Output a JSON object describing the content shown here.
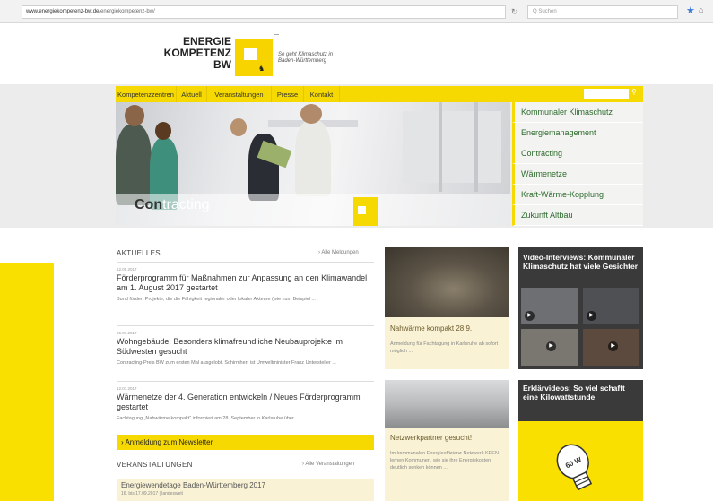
{
  "browser": {
    "url_domain": "www.energiekompetenz-bw.de",
    "url_path": "/energiekompetenz-bw/",
    "search_placeholder": "Q Suchen"
  },
  "logo": {
    "line1": "ENERGIE",
    "line2": "KOMPETENZ",
    "line3": "BW",
    "tagline": "So geht Klimaschutz in Baden-Württemberg"
  },
  "nav": {
    "items": [
      "Kompetenzzentren",
      "Aktuell",
      "Veranstaltungen",
      "Presse",
      "Kontakt"
    ]
  },
  "hero": {
    "title_dark": "Con",
    "title_light": "tracting"
  },
  "side_menu": {
    "items": [
      "Kommunaler Klimaschutz",
      "Energiemanagement",
      "Contracting",
      "Wärmenetze",
      "Kraft-Wärme-Kopplung",
      "Zukunft Altbau"
    ]
  },
  "aktuelles": {
    "title": "AKTUELLES",
    "more": "› Alle Meldungen",
    "items": [
      {
        "date": "12.09.2017",
        "title": "Förderprogramm für Maßnahmen zur Anpassung an den Klimawandel am 1. August 2017 gestartet",
        "text": "Bund fördert Projekte, die die Fähigkeit regionaler oder lokaler Akteure (wie zum Beispiel ..."
      },
      {
        "date": "26.07.2017",
        "title": "Wohngebäude: Besonders klimafreundliche Neubauprojekte im Südwesten gesucht",
        "text": "Contracting-Preis BW zum ersten Mal ausgelobt. Schirmherr ist Umweltminister Franz Untersteller ..."
      },
      {
        "date": "12.07.2017",
        "title": "Wärmenetze der 4. Generation entwickeln / Neues Förderprogramm gestartet",
        "text": "Fachtagung „Nahwärme kompakt“ informiert am 28. September in Karlsruhe über"
      }
    ]
  },
  "newsletter": {
    "label": "› Anmeldung zum Newsletter"
  },
  "veranstaltungen": {
    "title": "VERANSTALTUNGEN",
    "more": "› Alle Veranstaltungen",
    "event_title": "Energiewendetage Baden-Württemberg 2017",
    "event_meta": "16. bis 17.09.2017 | landesweit"
  },
  "cards": [
    {
      "title": "Nahwärme kompakt 28.9.",
      "text": "Anmeldung für Fachtagung in Karlsruhe ab sofort möglich ..."
    },
    {
      "title": "Netzwerkpartner gesucht!",
      "text": "Im kommunalen Energieeffizienz-Netzwerk KEEN lernen Kommunen, wie sie ihre Energiekosten deutlich senken können ..."
    }
  ],
  "video": {
    "title": "Video-Interviews: Kommunaler Klimaschutz hat viele Gesichter"
  },
  "erklaer": {
    "title": "Erklärvideos: So viel schafft eine Kilowattstunde",
    "bulb_label": "60 W"
  },
  "colors": {
    "brand_yellow": "#f6d900",
    "side_menu_text": "#2d6b2d",
    "dark_box": "#3a3a3a"
  }
}
